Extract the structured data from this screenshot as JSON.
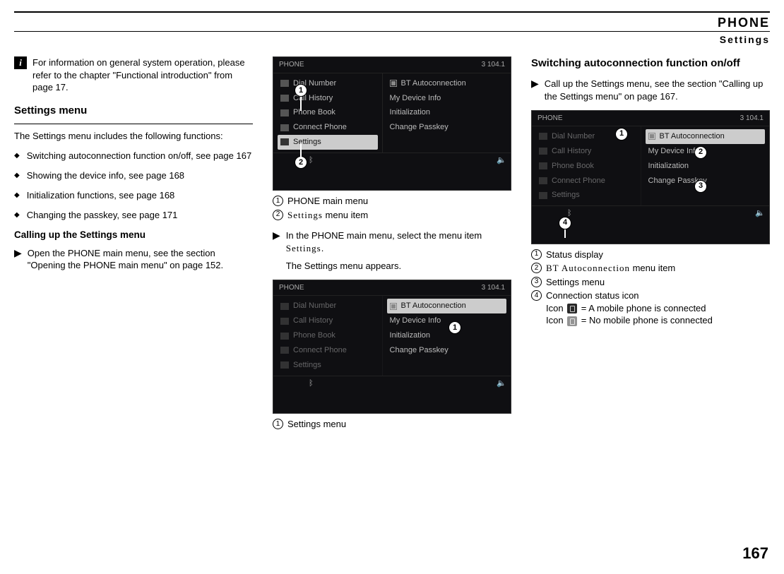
{
  "header": {
    "title": "PHONE",
    "subtitle": "Settings"
  },
  "col1": {
    "info_note": "For information on general system operation, please refer to the chapter \"Functional introduction\" from page 17.",
    "settings_menu_heading": "Settings menu",
    "settings_menu_intro": "The Settings menu includes the following functions:",
    "bullets": [
      "Switching autoconnection function on/off, see page 167",
      "Showing the device info, see page 168",
      "Initialization functions, see page 168",
      "Changing the passkey, see page 171"
    ],
    "calling_heading": "Calling up the Settings menu",
    "calling_step": "Open the PHONE main menu, see the section \"Opening the PHONE main menu\" on page 152."
  },
  "col2": {
    "ss1_header_left": "PHONE",
    "ss1_header_right": "3   104.1",
    "ss1_left_items": [
      "Dial Number",
      "Call History",
      "Phone Book",
      "Connect Phone",
      "Settings"
    ],
    "ss1_right_items": [
      "BT Autoconnection",
      "My Device Info",
      "Initialization",
      "Change Passkey"
    ],
    "ss1_legend1": "PHONE main menu",
    "ss1_legend2_prefix": "",
    "ss1_legend2_menuword": "Settings",
    "ss1_legend2_suffix": " menu item",
    "step1_a": "In the PHONE main menu, select the menu item ",
    "step1_menuword": "Settings",
    "step1_b": ".",
    "step1_result": "The Settings menu appears.",
    "ss2_legend1": "Settings menu"
  },
  "col3": {
    "switch_heading": "Switching autoconnection function on/off",
    "switch_step": "Call up the Settings menu, see the section \"Calling up the Settings menu\" on page 167.",
    "ss3_left_items": [
      "Dial Number",
      "Call History",
      "Phone Book",
      "Connect Phone",
      "Settings"
    ],
    "ss3_right_items": [
      "BT Autoconnection",
      "My Device Info",
      "Initialization",
      "Change Passkey"
    ],
    "legend1": "Status display",
    "legend2_menuword": "BT Autoconnection",
    "legend2_suffix": " menu item",
    "legend3": "Settings menu",
    "legend4_a": "Connection status icon",
    "legend4_b": " = A mobile phone is connected",
    "legend4_b_prefix": "Icon ",
    "legend4_c_prefix": "Icon ",
    "legend4_c": " = No mobile phone is connected"
  },
  "page_number": "167"
}
